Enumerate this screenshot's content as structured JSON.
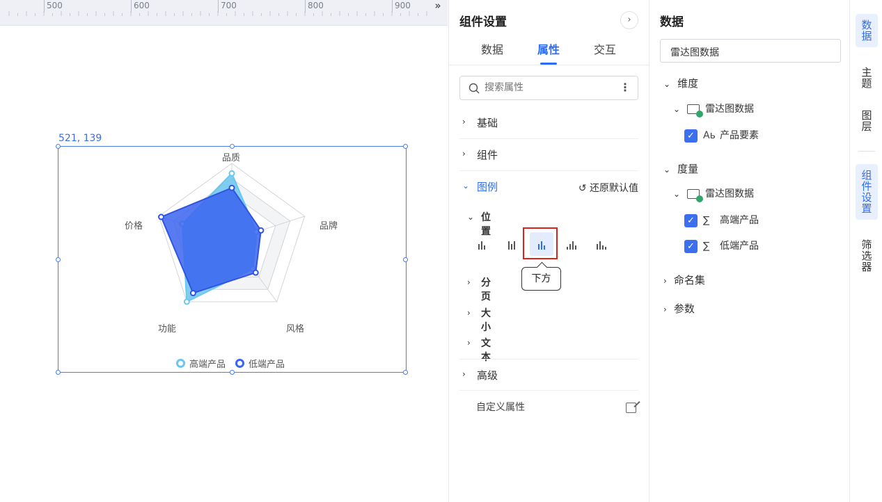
{
  "ruler": {
    "labels": [
      "500",
      "600",
      "700",
      "800",
      "900"
    ],
    "collapse_icon": "double-chevron-right"
  },
  "canvas": {
    "coordinate_readout": "521, 139",
    "radar": {
      "indicators": [
        "品质",
        "品牌",
        "风格",
        "功能",
        "价格"
      ],
      "legend": [
        "高端产品",
        "低端产品"
      ],
      "colors": {
        "high": "#6ac7ee",
        "low": "#3b64f0"
      }
    }
  },
  "chart_data": {
    "type": "radar",
    "indicators": [
      "品质",
      "品牌",
      "风格",
      "功能",
      "价格"
    ],
    "series": [
      {
        "name": "高端产品",
        "values": [
          0.87,
          0.34,
          0.47,
          1.0,
          0.68
        ]
      },
      {
        "name": "低端产品",
        "values": [
          0.68,
          0.4,
          0.53,
          0.86,
          0.97
        ]
      }
    ],
    "legend_position": "bottom"
  },
  "settings": {
    "title": "组件设置",
    "tabs": [
      "数据",
      "属性",
      "交互"
    ],
    "active_tab": "属性",
    "search_placeholder": "搜索属性",
    "sections": {
      "basic": "基础",
      "component": "组件",
      "legend": "图例",
      "advanced": "高级"
    },
    "reset_label": "还原默认值",
    "legend_sub": {
      "position": "位置",
      "paging": "分页",
      "size": "大小",
      "text": "文本"
    },
    "tooltip": "下方",
    "custom_props": "自定义属性",
    "accent": "#2f6cf0"
  },
  "data_panel": {
    "title": "数据",
    "dataset": "雷达图数据",
    "dimension_label": "维度",
    "dimension_source": "雷达图数据",
    "dimension_field": "产品要素",
    "dimension_field_icon": "Aь",
    "measure_label": "度量",
    "measure_source": "雷达图数据",
    "measure_fields": [
      "高端产品",
      "低端产品"
    ],
    "measure_icon": "∑",
    "named_sets": "命名集",
    "params": "参数"
  },
  "sidebar": {
    "items": [
      "数\n据",
      "主\n题",
      "图\n层",
      "组\n件\n设\n置",
      "筛\n选\n器"
    ]
  }
}
